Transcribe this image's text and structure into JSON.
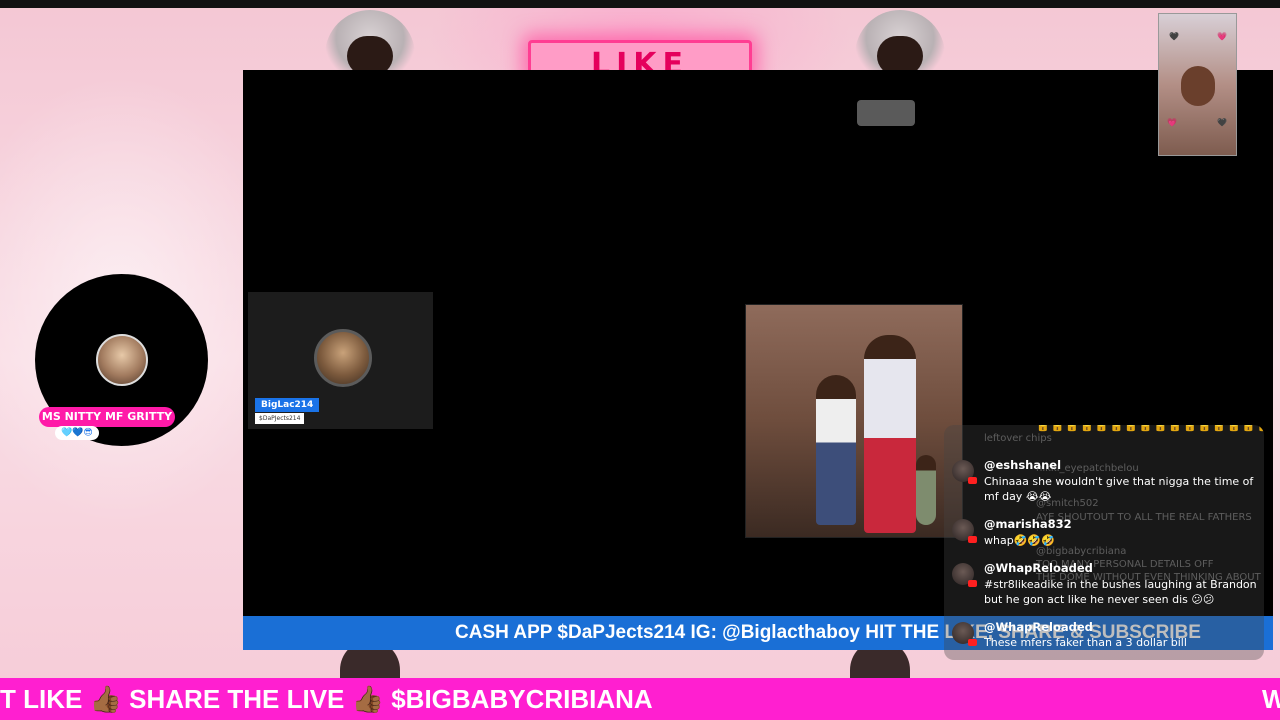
{
  "background": {
    "neon_sign_text": "LIKE",
    "accent_color": "#ff1fd0",
    "banner_color": "#1a6fd6"
  },
  "host": {
    "name": "MS NITTY MF GRITTY",
    "emoji_badge": "🩵💙😎"
  },
  "guest": {
    "name": "BigLac214",
    "subtitle": "$DaPJects214"
  },
  "banner": {
    "text": "CASH APP $DaPJects214 IG: @Biglacthaboy HIT THE LIKE, SHARE & SUBSCRIBE"
  },
  "chat": {
    "ghost_lines": [
      "leftover chips",
      "nikki_eyepatchbelou",
      "@smitch502",
      "AYE SHOUTOUT TO ALL THE REAL FATHERS",
      "@bigbabycribiana",
      "TOO MANY PERSONAL DETAILS OFF",
      "THE DOME WITHOUT EVEN THINKING ABOUT"
    ],
    "ghost_emojis": "🔒🔒🔒🔒🔒🔒🔒🔒🔒🔒🔒🔒🔒🔒🔒🔒🔒🔒",
    "messages": [
      {
        "user": "@eshshanel",
        "text": "Chinaaa she wouldn't give that nigga the time of mf day 😭😭"
      },
      {
        "user": "@marisha832",
        "text": "whap🤣🤣🤣"
      },
      {
        "user": "@WhapReloaded",
        "text": "#str8likeadike in the bushes laughing at Brandon but he gon act like he never seen dis 😕😕"
      },
      {
        "user": "@WhapReloaded",
        "text": "These mfers faker than a 3 dollar bill"
      }
    ]
  },
  "ticker": {
    "text": "T LIKE 👍🏾 SHARE THE LIVE 👍🏾 $BIGBABYCRIBIANA",
    "tail": "W"
  }
}
